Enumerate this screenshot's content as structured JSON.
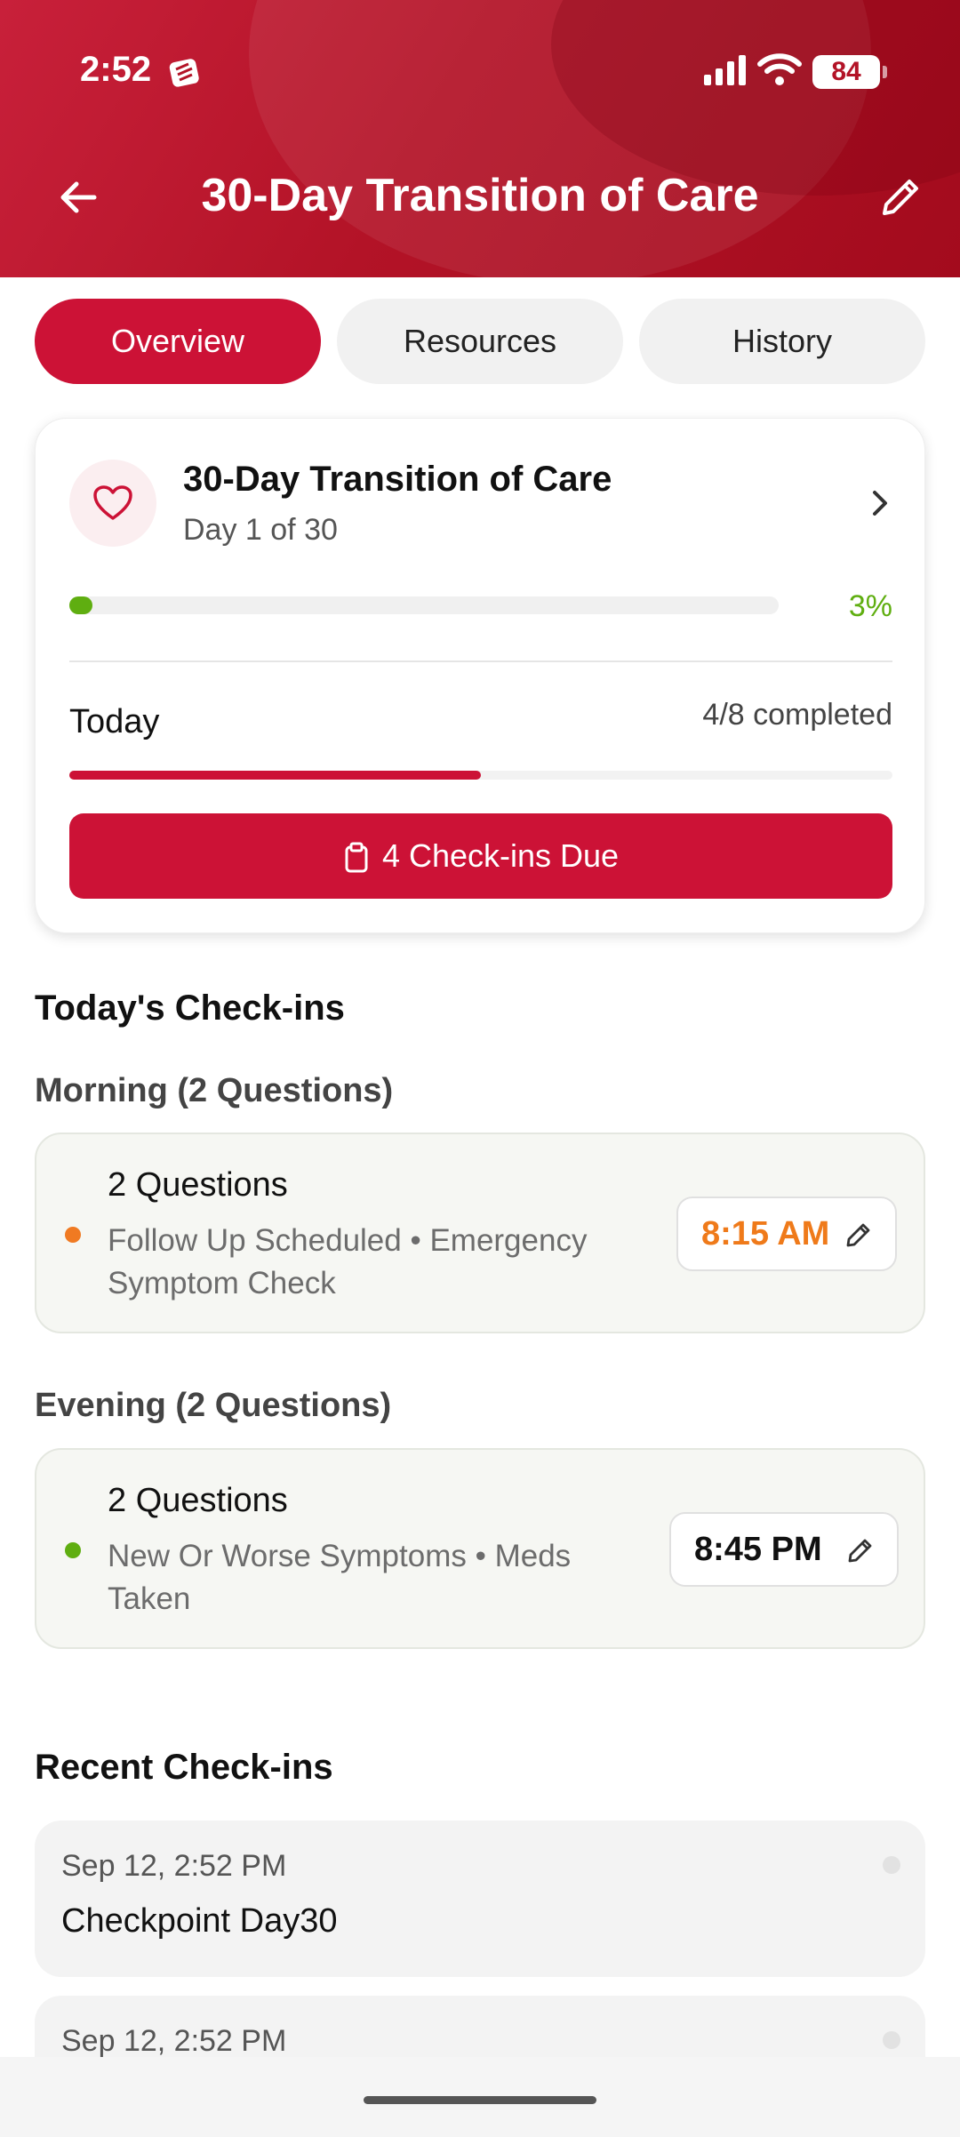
{
  "status_bar": {
    "time": "2:52",
    "battery": "84"
  },
  "header": {
    "title": "30-Day Transition of Care"
  },
  "tabs": [
    {
      "label": "Overview",
      "active": true
    },
    {
      "label": "Resources",
      "active": false
    },
    {
      "label": "History",
      "active": false
    }
  ],
  "program_card": {
    "title": "30-Day Transition of Care",
    "subtitle": "Day 1 of 30",
    "progress_percent": 3,
    "progress_label": "3%",
    "today_label": "Today",
    "today_count": "4/8 completed",
    "today_fraction": 0.5,
    "due_button": "4 Check-ins Due"
  },
  "todays_checkins": {
    "heading": "Today's Check-ins",
    "groups": [
      {
        "heading": "Morning (2 Questions)",
        "title": "2 Questions",
        "description": "Follow Up Scheduled • Emergency Symptom Check",
        "time": "8:15 AM",
        "dot_color": "#f07a22",
        "time_color": "#ef7a1a"
      },
      {
        "heading": "Evening (2 Questions)",
        "title": "2 Questions",
        "description": "New Or Worse Symptoms • Meds Taken",
        "time": "8:45 PM",
        "dot_color": "#5fae10",
        "time_color": "#111111"
      }
    ]
  },
  "recent_checkins": {
    "heading": "Recent Check-ins",
    "items": [
      {
        "date": "Sep 12, 2:52 PM",
        "title": "Checkpoint Day30"
      },
      {
        "date": "Sep 12, 2:52 PM",
        "title": ""
      }
    ]
  },
  "colors": {
    "brand": "#cc1236",
    "success": "#5fae10",
    "warning": "#ef7a1a"
  }
}
